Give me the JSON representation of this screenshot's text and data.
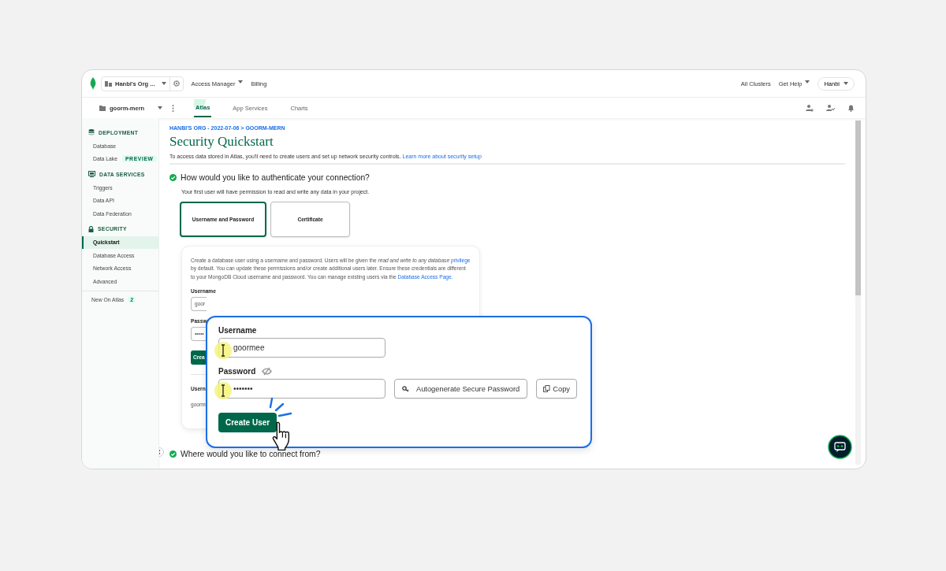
{
  "topbar": {
    "org": "Hanbi's Org ...",
    "menus": [
      {
        "label": "Access Manager",
        "dropdown": true
      },
      {
        "label": "Billing",
        "dropdown": false
      }
    ],
    "right": [
      {
        "label": "All Clusters",
        "dropdown": false
      },
      {
        "label": "Get Help",
        "dropdown": true
      }
    ],
    "user": "Hanbi"
  },
  "project_bar": {
    "project": "goorm-mern",
    "tabs": [
      {
        "label": "Atlas",
        "selected": true
      },
      {
        "label": "App Services",
        "selected": false
      },
      {
        "label": "Charts",
        "selected": false
      }
    ]
  },
  "sidebar": {
    "sections": [
      {
        "title": "DEPLOYMENT",
        "items": [
          {
            "label": "Database",
            "selected": false
          },
          {
            "label": "Data Lake",
            "badge": "PREVIEW",
            "selected": false
          }
        ]
      },
      {
        "title": "DATA SERVICES",
        "items": [
          {
            "label": "Triggers",
            "selected": false
          },
          {
            "label": "Data API",
            "selected": false
          },
          {
            "label": "Data Federation",
            "selected": false
          }
        ]
      },
      {
        "title": "SECURITY",
        "items": [
          {
            "label": "Quickstart",
            "selected": true
          },
          {
            "label": "Database Access",
            "selected": false
          },
          {
            "label": "Network Access",
            "selected": false
          },
          {
            "label": "Advanced",
            "selected": false
          }
        ]
      }
    ],
    "new_on_atlas": {
      "label": "New On Atlas",
      "count": "2"
    }
  },
  "main": {
    "breadcrumb": "HANBI'S ORG - 2022-07-06 > GOORM-MERN",
    "title": "Security Quickstart",
    "intro": "To access data stored in Atlas, you'll need to create users and set up network security controls.",
    "intro_link": "Learn more about security setup",
    "steps": [
      {
        "question": "How would you like to authenticate your connection?",
        "done": true
      }
    ],
    "note": "Your first user will have permission to read and write any data in your project.",
    "auth_options": [
      {
        "label": "Username and Password",
        "selected": true
      },
      {
        "label": "Certificate",
        "selected": false
      }
    ],
    "card": {
      "description": [
        {
          "kind": "text",
          "text": "Create a database user using a username and password. Users will be given the *read and write to any database*"
        },
        {
          "kind": "link",
          "text": "privilege"
        },
        {
          "kind": "text",
          "text": "by default. You can update these permissions and/or create additional users later. Ensure these credentials are different to your MongoDB Cloud username and password. You can manage existing users via the"
        },
        {
          "kind": "link",
          "text": "Database Access Page."
        }
      ],
      "username_label": "Username",
      "username_value": "goor",
      "password_label": "Passw",
      "password_value": "•••••",
      "button": "Crea",
      "user_label": "Usern",
      "user_value": "goorm"
    },
    "step2": {
      "question": "Where would you like to connect from?",
      "done": true
    }
  },
  "callout": {
    "username_label": "Username",
    "username_value": "goormee",
    "password_label": "Password",
    "password_value": "•••••••",
    "autogenerate": "Autogenerate Secure Password",
    "copy": "Copy",
    "create": "Create User"
  }
}
